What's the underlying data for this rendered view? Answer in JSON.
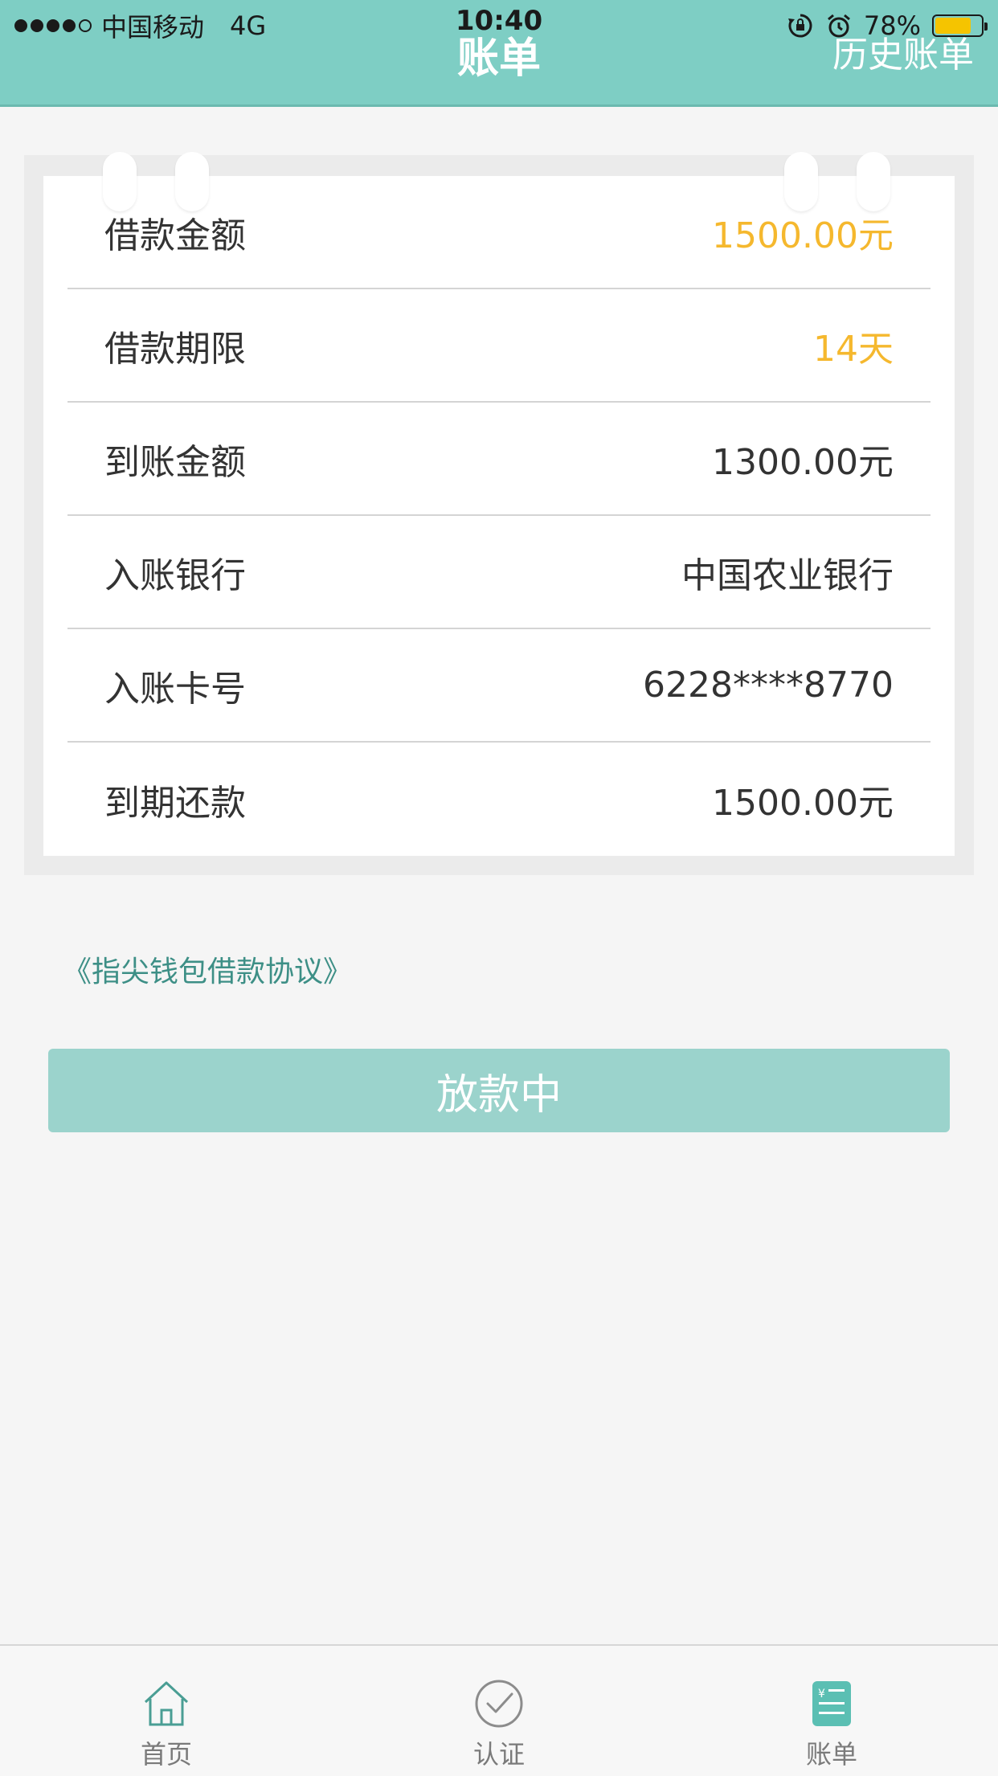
{
  "status_bar": {
    "carrier": "中国移动",
    "network": "4G",
    "time": "10:40",
    "battery": "78%",
    "battery_level": 0.78
  },
  "header": {
    "title": "账单",
    "history_link": "历史账单"
  },
  "bill": {
    "rows": [
      {
        "label": "借款金额",
        "value": "1500.00元"
      },
      {
        "label": "借款期限",
        "value": "14天"
      },
      {
        "label": "到账金额",
        "value": "1300.00元"
      },
      {
        "label": "入账银行",
        "value": "中国农业银行"
      },
      {
        "label": "入账卡号",
        "value": "6228****8770"
      },
      {
        "label": "到期还款",
        "value": "1500.00元"
      }
    ]
  },
  "agreement_link": "《指尖钱包借款协议》",
  "main_button": "放款中",
  "tabbar": {
    "items": [
      {
        "label": "首页",
        "icon": "home-icon"
      },
      {
        "label": "认证",
        "icon": "check-circle-icon"
      },
      {
        "label": "账单",
        "icon": "bill-icon"
      }
    ]
  },
  "colors": {
    "header": "#7ecec4",
    "accent_value": "#f5b82e",
    "button": "#9bd3cc",
    "link": "#3d8f86",
    "active_tab_icon": "#5bbfb3"
  }
}
